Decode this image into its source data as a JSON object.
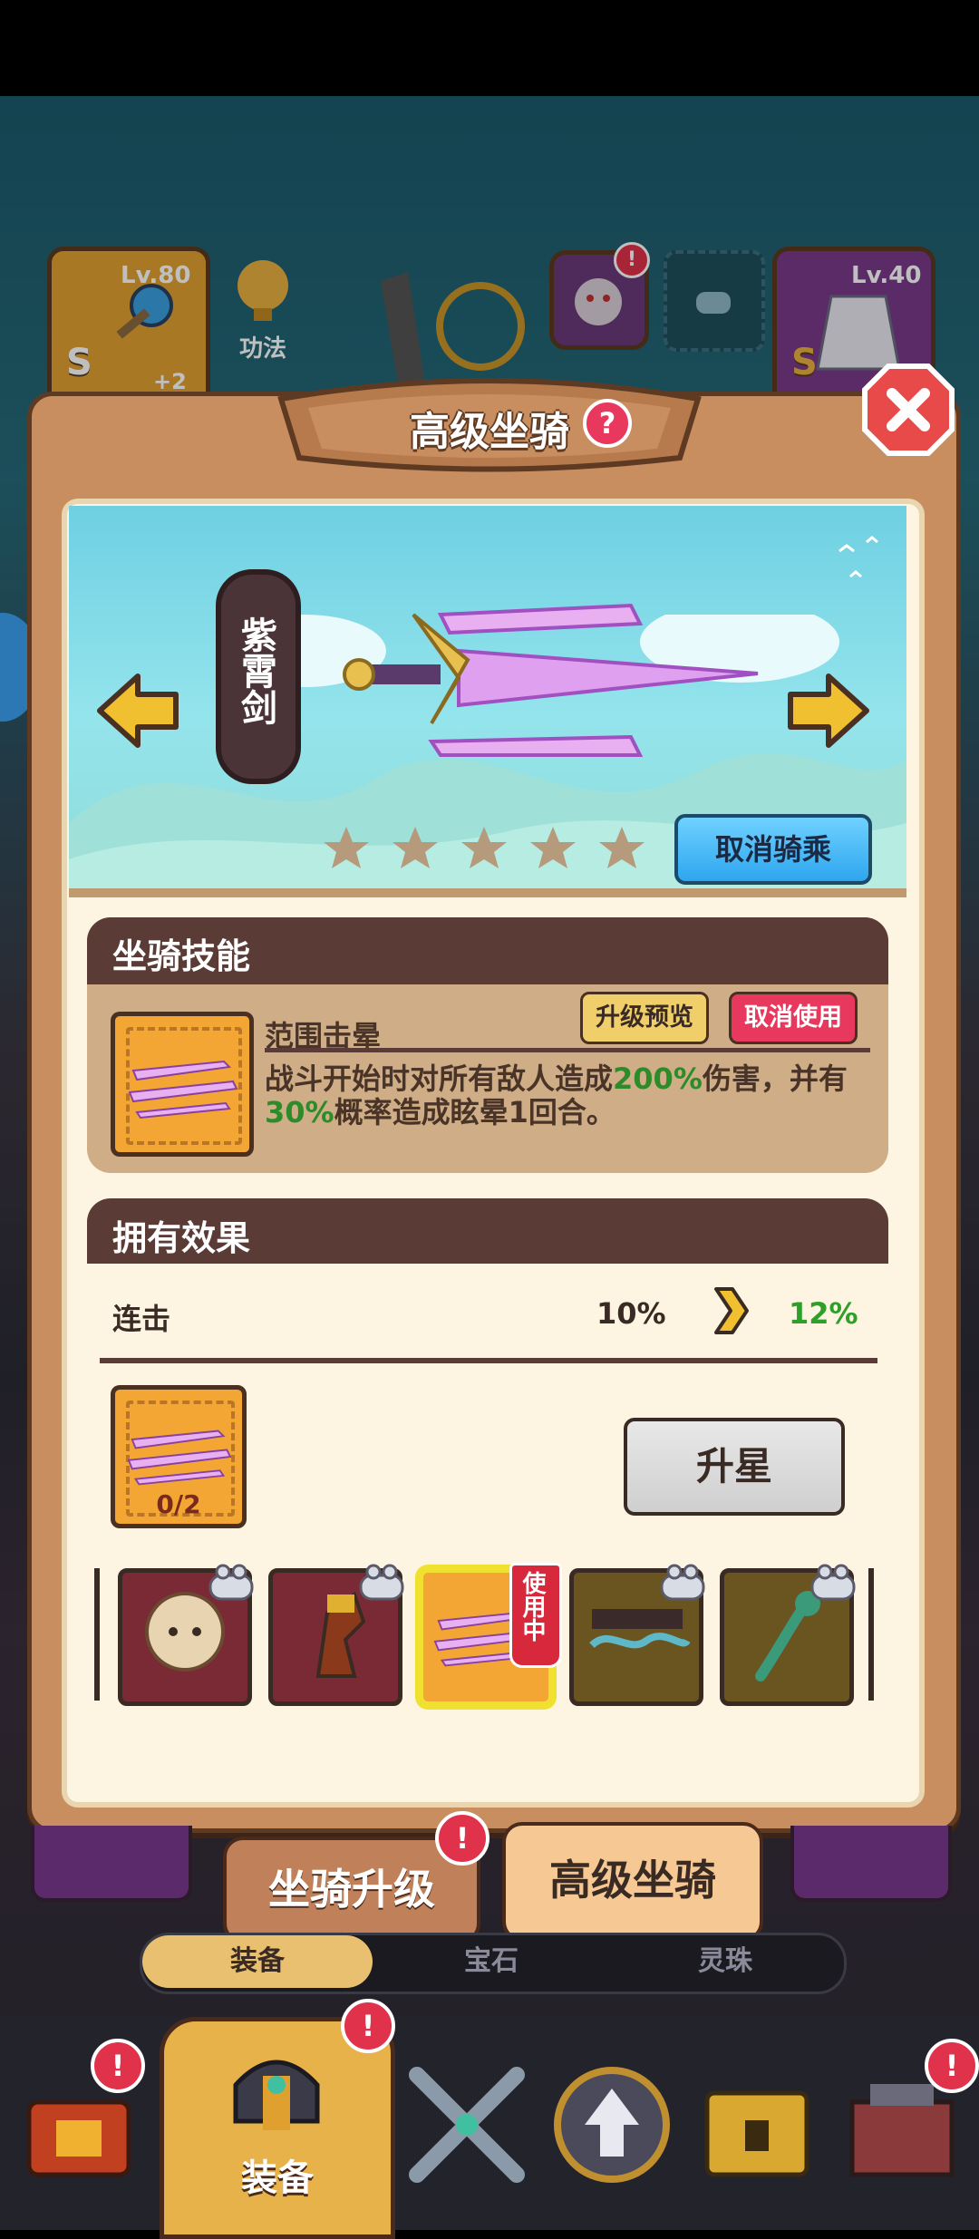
{
  "header": {
    "title": "高级坐骑",
    "help_label": "?"
  },
  "top_bar": {
    "left_level": "Lv.80",
    "left_grade": "S",
    "left_plus": "+2",
    "center_label": "功法",
    "right_level": "Lv.40",
    "right_grade": "S"
  },
  "hero": {
    "mount_name": "紫霄剑",
    "unride_label": "取消骑乘",
    "stars_total": 5,
    "stars_filled": 0
  },
  "skill": {
    "section_title": "坐骑技能",
    "name": "范围击晕",
    "preview_label": "升级预览",
    "cancel_use_label": "取消使用",
    "desc_part1": "战斗开始时对所有敌人造成",
    "desc_value1": "200%",
    "desc_part2": "伤害，并有",
    "desc_value2": "30%",
    "desc_part3": "概率造成眩晕1回合。"
  },
  "effects": {
    "section_title": "拥有效果",
    "stat_name": "连击",
    "current_value": "10%",
    "next_value": "12%"
  },
  "upgrade": {
    "item_count": "0/2",
    "star_up_label": "升星"
  },
  "mount_list": {
    "in_use_label": "使用中",
    "items": [
      {
        "icon": "sheep-mount-icon",
        "locked": true,
        "bg": "#7a2a34"
      },
      {
        "icon": "horse-mount-icon",
        "locked": true,
        "bg": "#7a2a34"
      },
      {
        "icon": "flying-sword-mount-icon",
        "locked": false,
        "bg": "#f3a634",
        "in_use": true
      },
      {
        "icon": "cloud-mount-icon",
        "locked": true,
        "bg": "#6a5520"
      },
      {
        "icon": "ruyi-mount-icon",
        "locked": true,
        "bg": "#6a5520"
      }
    ]
  },
  "tabs": {
    "mount_upgrade": "坐骑升级",
    "advanced_mount": "高级坐骑"
  },
  "subtabs": [
    "装备",
    "宝石",
    "灵珠"
  ],
  "bottom_nav": {
    "equipment_label": "装备",
    "badge": "!"
  },
  "colors": {
    "accent_green": "#2e8b2a",
    "unride_blue": "#2ea6ef",
    "badge_red": "#e0324a"
  }
}
